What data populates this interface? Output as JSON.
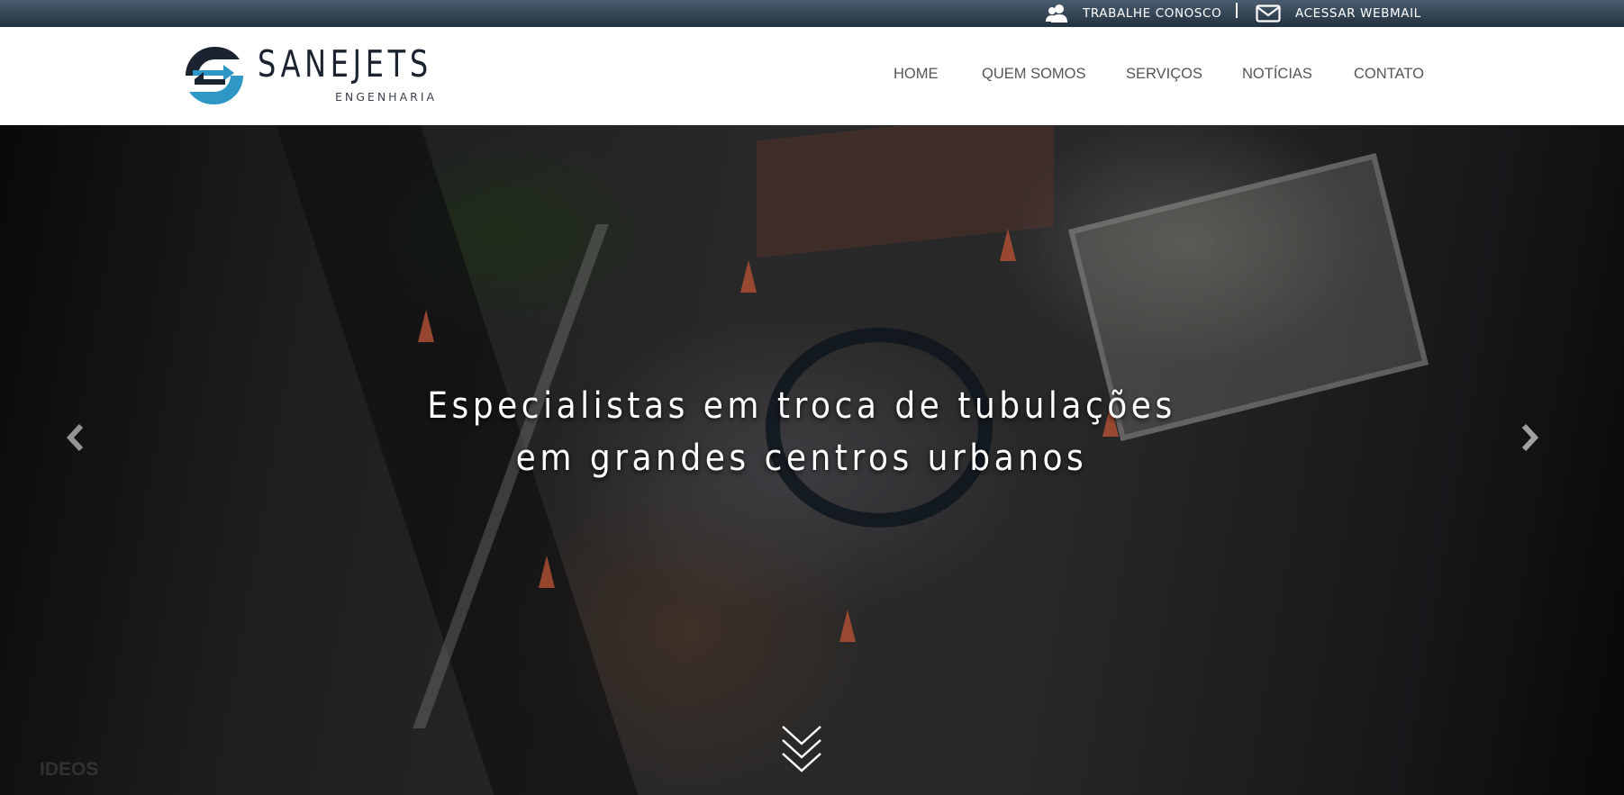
{
  "topbar": {
    "work_label": "TRABALHE CONOSCO",
    "work_icon": "people-icon",
    "webmail_label": "ACESSAR WEBMAIL",
    "webmail_icon": "mail-icon"
  },
  "logo": {
    "name": "SANEJETS",
    "subtitle": "ENGENHARIA",
    "colors": {
      "dark": "#1b2230",
      "blue": "#2f97c6"
    }
  },
  "nav": {
    "items": [
      {
        "label": "HOME"
      },
      {
        "label": "QUEM SOMOS"
      },
      {
        "label": "SERVIÇOS"
      },
      {
        "label": "NOTÍCIAS"
      },
      {
        "label": "CONTATO"
      }
    ]
  },
  "hero": {
    "caption_line1": "Especialistas em troca de tubulações",
    "caption_line2": "em grandes centros urbanos",
    "prev_icon": "chevron-left-icon",
    "next_icon": "chevron-right-icon",
    "scroll_icon": "triple-chevron-down-icon",
    "faded_label": "IDEOS"
  },
  "colors": {
    "topbar": "#22313f",
    "nav_text": "#555555"
  }
}
